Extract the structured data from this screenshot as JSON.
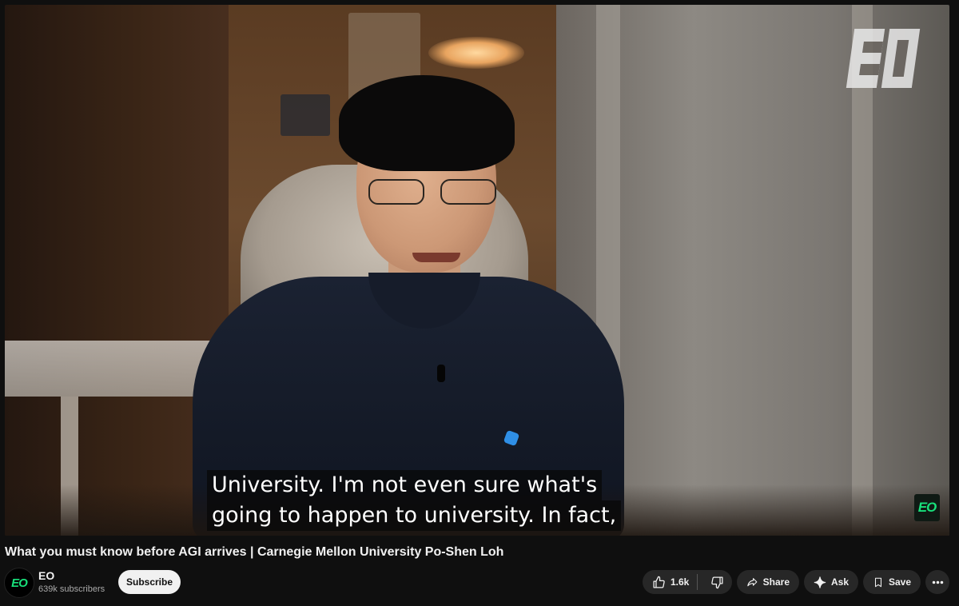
{
  "video": {
    "watermark_text": "EO",
    "corner_logo_text": "EO",
    "captions": [
      "University. I'm not even sure what's",
      "going to happen to university. In fact,"
    ]
  },
  "title": "What you must know before AGI arrives | Carnegie Mellon University Po-Shen Loh",
  "channel": {
    "avatar_text": "EO",
    "name": "EO",
    "subscribers": "639k subscribers",
    "subscribe_label": "Subscribe"
  },
  "actions": {
    "like_count": "1.6k",
    "share_label": "Share",
    "ask_label": "Ask",
    "save_label": "Save"
  },
  "colors": {
    "background": "#0f0f0f",
    "pill": "#272727",
    "brand_green": "#18e07b",
    "subscribe_bg": "#f1f1f1"
  },
  "icons": [
    "thumbs-up-icon",
    "thumbs-down-icon",
    "share-arrow-icon",
    "sparkle-icon",
    "bookmark-icon",
    "more-dots-icon"
  ]
}
